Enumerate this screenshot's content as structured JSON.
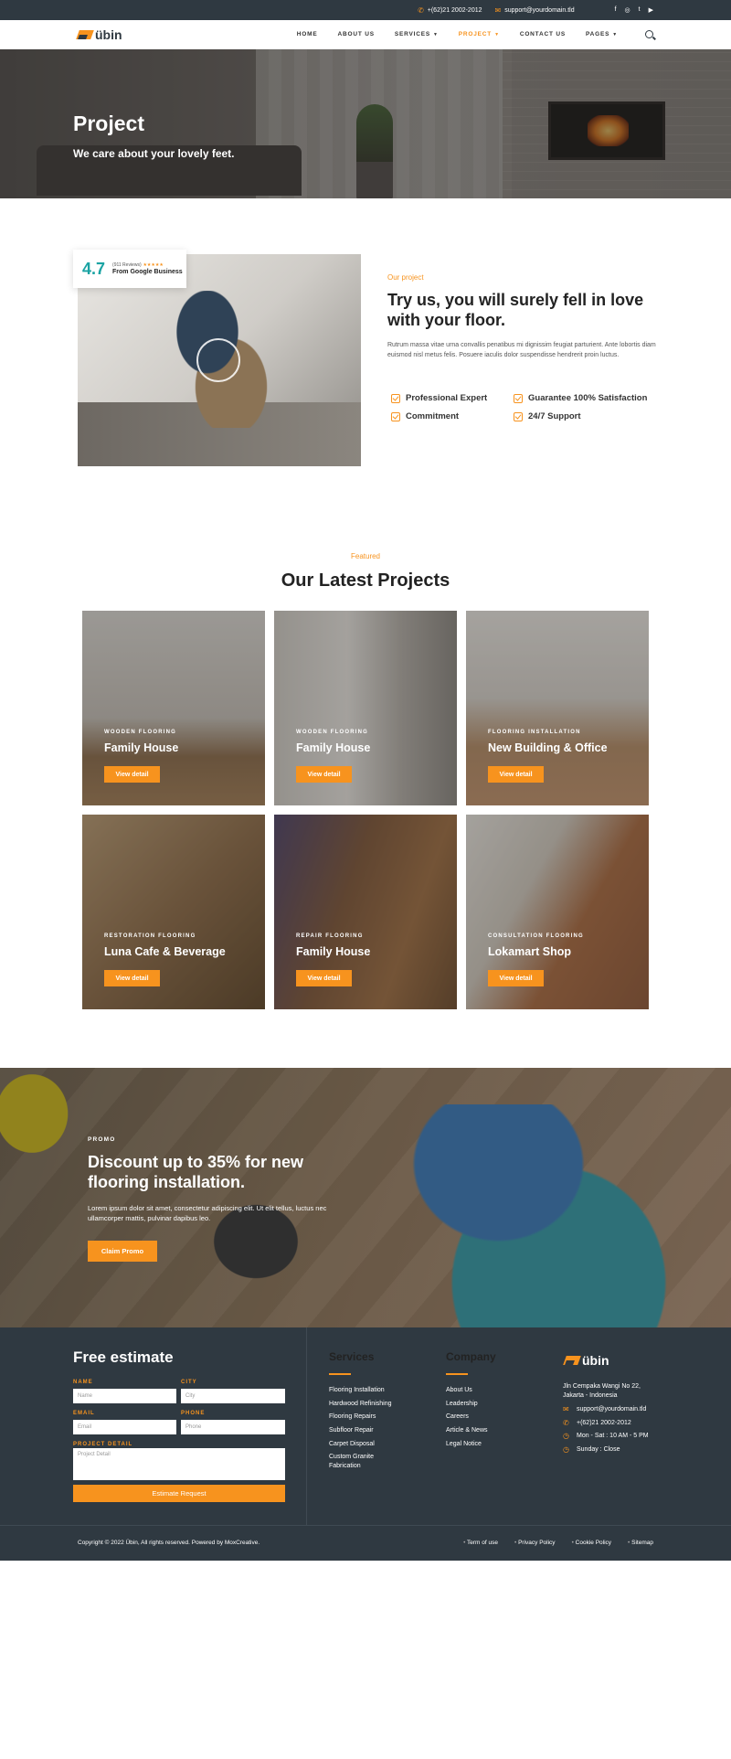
{
  "topbar": {
    "phone": "+(62)21 2002-2012",
    "email": "support@yourdomain.tld",
    "social": [
      "f",
      "◎",
      "t",
      "▶"
    ]
  },
  "nav": {
    "logo": "übin",
    "items": [
      {
        "label": "HOME"
      },
      {
        "label": "ABOUT US"
      },
      {
        "label": "SERVICES"
      },
      {
        "label": "PROJECT"
      },
      {
        "label": "CONTACT US"
      },
      {
        "label": "PAGES"
      }
    ]
  },
  "hero": {
    "title": "Project",
    "subtitle": "We care about your lovely feet."
  },
  "about": {
    "rating_value": "4.7",
    "rating_reviews": "(911 Reviews)",
    "rating_source": "From Google Business",
    "eyebrow": "Our project",
    "title": "Try us, you will surely fell in love with your floor.",
    "description": "Rutrum massa vitae urna convallis penatibus mi dignissim feugiat parturient. Ante lobortis diam euismod nisl metus felis. Posuere iaculis dolor suspendisse hendrerit proin luctus.",
    "features": [
      "Professional Expert",
      "Guarantee 100% Satisfaction",
      "Commitment",
      "24/7 Support"
    ]
  },
  "projects": {
    "eyebrow": "Featured",
    "title": "Our Latest Projects",
    "button_label": "View detail",
    "items": [
      {
        "category": "WOODEN FLOORING",
        "title": "Family House"
      },
      {
        "category": "WOODEN FLOORING",
        "title": "Family House"
      },
      {
        "category": "FLOORING INSTALLATION",
        "title": "New Building & Office"
      },
      {
        "category": "RESTORATION FLOORING",
        "title": "Luna Cafe & Beverage"
      },
      {
        "category": "REPAIR FLOORING",
        "title": "Family House"
      },
      {
        "category": "CONSULTATION FLOORING",
        "title": "Lokamart Shop"
      }
    ]
  },
  "promo": {
    "eyebrow": "PROMO",
    "title": "Discount up to 35% for new flooring installation.",
    "text": "Lorem ipsum dolor sit amet, consectetur adipiscing elit. Ut elit tellus, luctus nec ullamcorper mattis, pulvinar dapibus leo.",
    "button": "Claim Promo"
  },
  "footer": {
    "estimate_title": "Free estimate",
    "labels": {
      "name": "NAME",
      "city": "CITY",
      "email": "EMAIL",
      "phone": "PHONE",
      "detail": "PROJECT DETAIL"
    },
    "placeholders": {
      "name": "Name",
      "city": "City",
      "email": "Email",
      "phone": "Phone",
      "detail": "Project Detail"
    },
    "submit": "Estimate Request",
    "services_title": "Services",
    "services": [
      "Flooring Installation",
      "Hardwood Refinishing",
      "Flooring Repairs",
      "Subfloor Repair",
      "Carpet Disposal",
      "Custom Granite Fabrication"
    ],
    "company_title": "Company",
    "company": [
      "About Us",
      "Leadership",
      "Careers",
      "Article & News",
      "Legal Notice"
    ],
    "logo": "übin",
    "address": "Jln Cempaka Wangi No 22, Jakarta - Indonesia",
    "email": "support@yourdomain.tld",
    "phone": "+(62)21 2002-2012",
    "hours": "Mon - Sat : 10 AM - 5 PM",
    "sunday": "Sunday : Close",
    "copyright": "Copyright © 2022 Übin, All rights reserved. Powered by MoxCreative.",
    "legal": [
      "Term of use",
      "Privacy Policy",
      "Cookie Policy",
      "Sitemap"
    ]
  }
}
